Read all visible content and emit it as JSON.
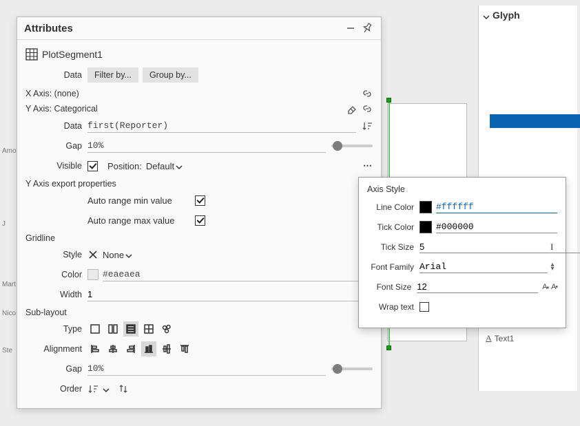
{
  "panel": {
    "title": "Attributes",
    "object_name": "PlotSegment1",
    "data": {
      "label": "Data",
      "filter_btn": "Filter by...",
      "group_btn": "Group by..."
    },
    "xaxis": {
      "label": "X Axis: (none)"
    },
    "yaxis": {
      "label": "Y Axis: Categorical",
      "data_label": "Data",
      "data_value": "first(Reporter)",
      "gap_label": "Gap",
      "gap_value": "10%",
      "visible_label": "Visible",
      "position_label": "Position:",
      "position_value": "Default",
      "export_label": "Y Axis export properties",
      "auto_min": "Auto range min value",
      "auto_max": "Auto range max value"
    },
    "gridline": {
      "label": "Gridline",
      "style_label": "Style",
      "style_value": "None",
      "color_label": "Color",
      "color_value": "#eaeaea",
      "width_label": "Width",
      "width_value": "1"
    },
    "sublayout": {
      "label": "Sub-layout",
      "type_label": "Type",
      "alignment_label": "Alignment",
      "gap_label": "Gap",
      "gap_value": "10%",
      "order_label": "Order"
    }
  },
  "popup": {
    "title": "Axis Style",
    "line_color": {
      "label": "Line Color",
      "value": "#ffffff",
      "swatch": "#000000"
    },
    "tick_color": {
      "label": "Tick Color",
      "value": "#000000",
      "swatch": "#000000"
    },
    "tick_size": {
      "label": "Tick Size",
      "value": "5"
    },
    "font_family": {
      "label": "Font Family",
      "value": "Arial"
    },
    "font_size": {
      "label": "Font Size",
      "value": "12"
    },
    "wrap_text": {
      "label": "Wrap text"
    }
  },
  "glyph": {
    "title": "Glyph",
    "item1": "Text1"
  },
  "side_labels": [
    "Amo",
    "J",
    "Mart",
    "Nico",
    "Ste"
  ]
}
